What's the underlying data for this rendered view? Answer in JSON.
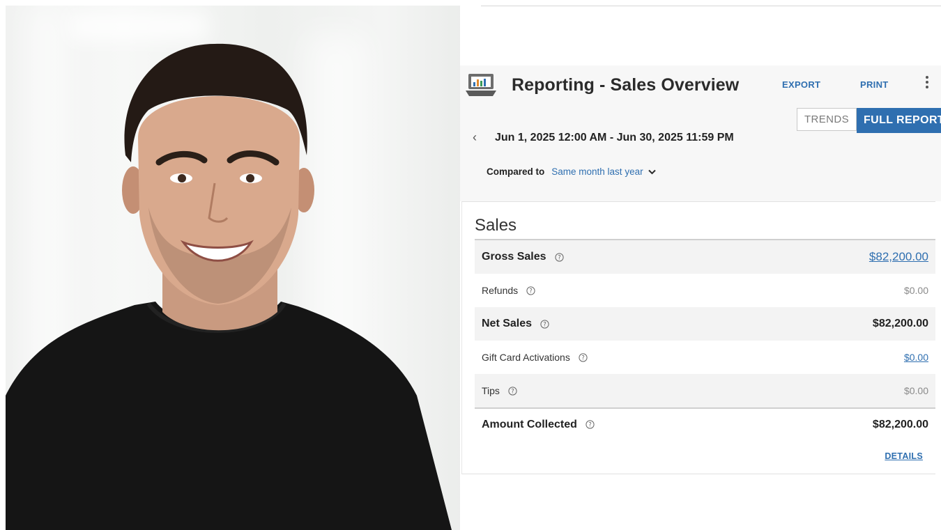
{
  "header": {
    "title": "Reporting - Sales Overview",
    "export_label": "EXPORT",
    "print_label": "PRINT",
    "more_icon": "more-vertical-icon",
    "app_icon": "report-chart-icon"
  },
  "view_toggle": {
    "trends_label": "TRENDS",
    "full_report_label": "FULL REPORT",
    "selected": "FULL REPORT"
  },
  "date_range": "Jun 1, 2025 12:00 AM - Jun 30, 2025 11:59 PM",
  "compare": {
    "label": "Compared to",
    "value": "Same month last year"
  },
  "sales": {
    "title": "Sales",
    "rows": [
      {
        "label": "Gross Sales",
        "value": "$82,200.00"
      },
      {
        "label": "Refunds",
        "value": "$0.00"
      },
      {
        "label": "Net Sales",
        "value": "$82,200.00"
      },
      {
        "label": "Gift Card Activations",
        "value": "$0.00"
      },
      {
        "label": "Tips",
        "value": "$0.00"
      },
      {
        "label": "Amount Collected",
        "value": "$82,200.00"
      }
    ],
    "details_label": "DETAILS"
  },
  "colors": {
    "accent": "#2f6fb0",
    "header_bg": "#f7f7f7",
    "row_shade": "#f3f3f3"
  }
}
